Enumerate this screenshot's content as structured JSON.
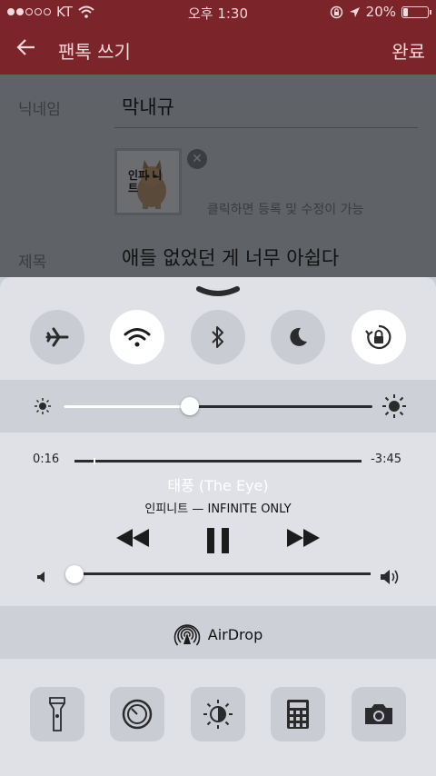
{
  "status_bar": {
    "carrier": "KT",
    "signal_bars_filled": 2,
    "signal_bars_total": 5,
    "time": "오후 1:30",
    "battery_percent": "20%",
    "battery_level": 0.2
  },
  "header": {
    "back_icon": "arrow-left-icon",
    "title": "팬톡 쓰기",
    "done_label": "완료"
  },
  "form": {
    "nickname_label": "닉네임",
    "nickname_value": "막내규",
    "image_overlay_text": "인피 니트",
    "image_hint": "클릭하면 등록 및 수정이 가능",
    "title_label": "제목",
    "title_value": "애들 없었던 게 너무 아쉽다"
  },
  "control_center": {
    "toggles": [
      {
        "name": "airplane-mode",
        "icon": "airplane-icon",
        "on": false
      },
      {
        "name": "wifi",
        "icon": "wifi-icon",
        "on": true
      },
      {
        "name": "bluetooth",
        "icon": "bluetooth-icon",
        "on": false
      },
      {
        "name": "do-not-disturb",
        "icon": "moon-icon",
        "on": false
      },
      {
        "name": "rotation-lock",
        "icon": "rotation-lock-icon",
        "on": true
      }
    ],
    "brightness_level": 0.41,
    "music": {
      "elapsed": "0:16",
      "remaining": "-3:45",
      "progress": 0.066,
      "title": "태풍 (The Eye)",
      "artist": "인피니트 — INFINITE ONLY",
      "volume_level": 0.0
    },
    "airdrop_label": "AirDrop",
    "shortcuts": [
      {
        "name": "flashlight",
        "icon": "flashlight-icon"
      },
      {
        "name": "timer",
        "icon": "timer-icon"
      },
      {
        "name": "night-shift",
        "icon": "night-shift-icon"
      },
      {
        "name": "calculator",
        "icon": "calculator-icon"
      },
      {
        "name": "camera",
        "icon": "camera-icon"
      }
    ]
  }
}
